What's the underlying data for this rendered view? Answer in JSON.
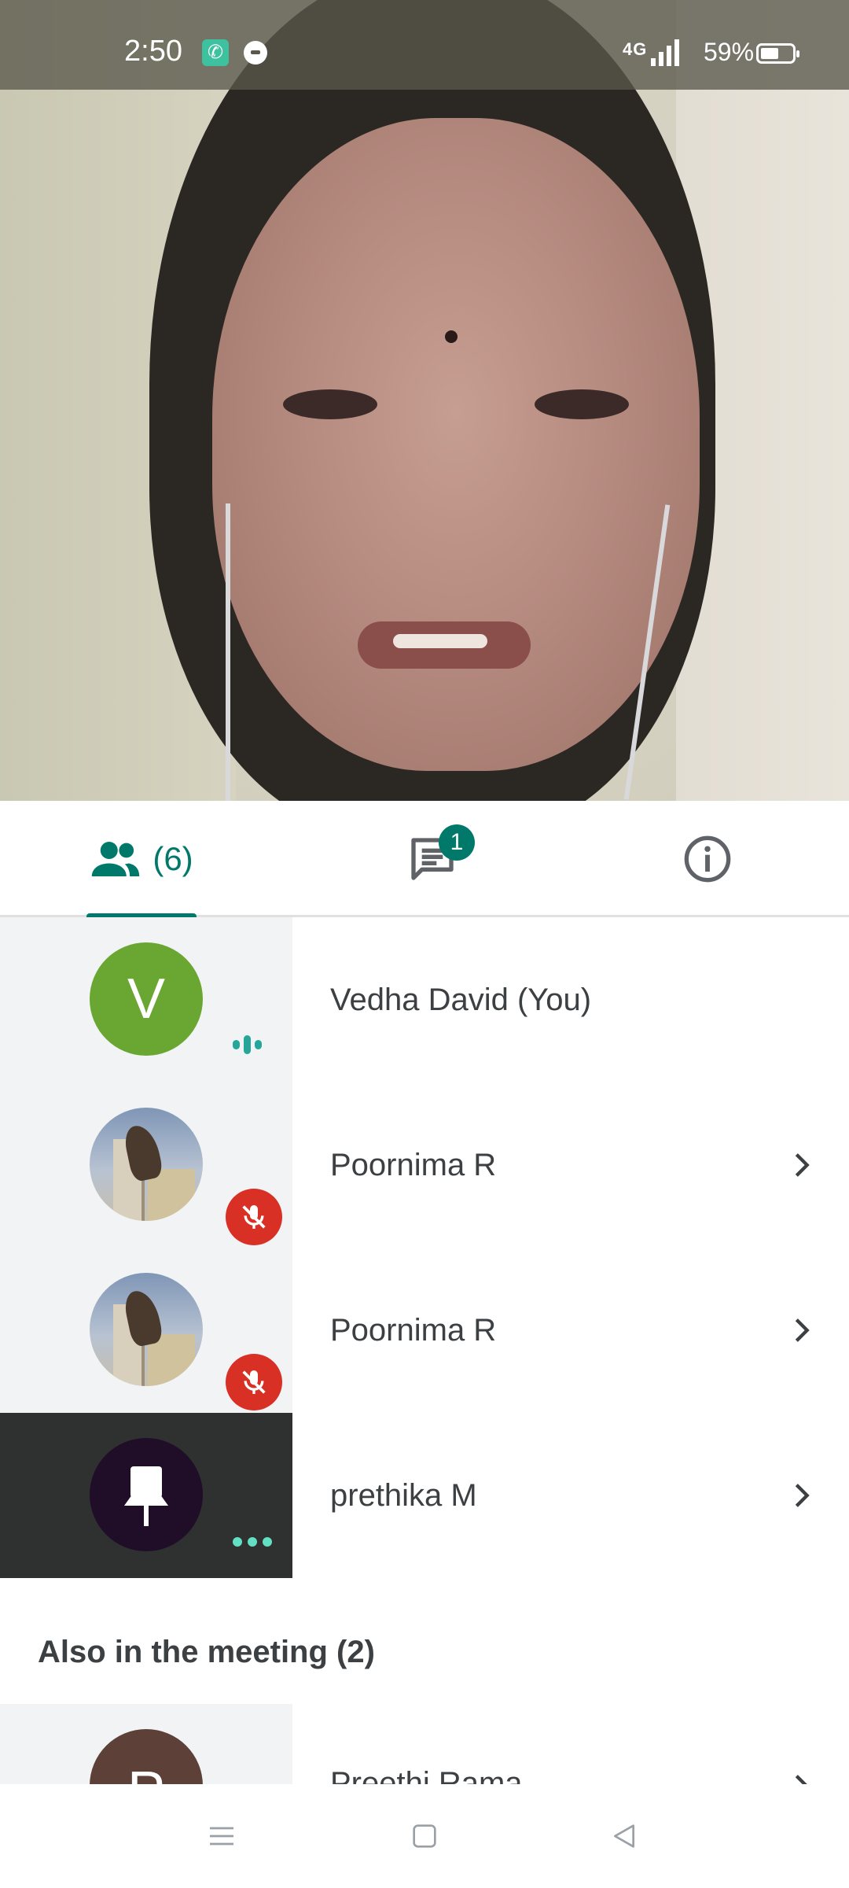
{
  "status_bar": {
    "time": "2:50",
    "network": "4G",
    "battery_percent": "59%",
    "battery_level": 0.59,
    "icons": [
      "phone-call-icon",
      "chat-bubble-icon",
      "volte-icon",
      "signal-icon",
      "battery-icon"
    ]
  },
  "tabs": {
    "people_count": "(6)",
    "chat_badge": "1",
    "active": "people"
  },
  "participants": [
    {
      "initial": "V",
      "name": "Vedha David (You)",
      "avatar": "letter",
      "avatar_color": "#6aa632",
      "status": "speaking"
    },
    {
      "name": "Poornima R",
      "avatar": "photo",
      "status": "muted"
    },
    {
      "name": "Poornima R",
      "avatar": "photo",
      "status": "muted"
    },
    {
      "name": "prethika M",
      "avatar": "pin",
      "status": "more"
    }
  ],
  "also_in_meeting": {
    "title": "Also in the meeting (2)",
    "items": [
      {
        "initial": "P",
        "name": "Preethi Rama",
        "avatar_color": "#5d4037"
      }
    ]
  },
  "colors": {
    "accent": "#00796b",
    "muted_red": "#d93025",
    "speaking_teal": "#26a69a"
  }
}
